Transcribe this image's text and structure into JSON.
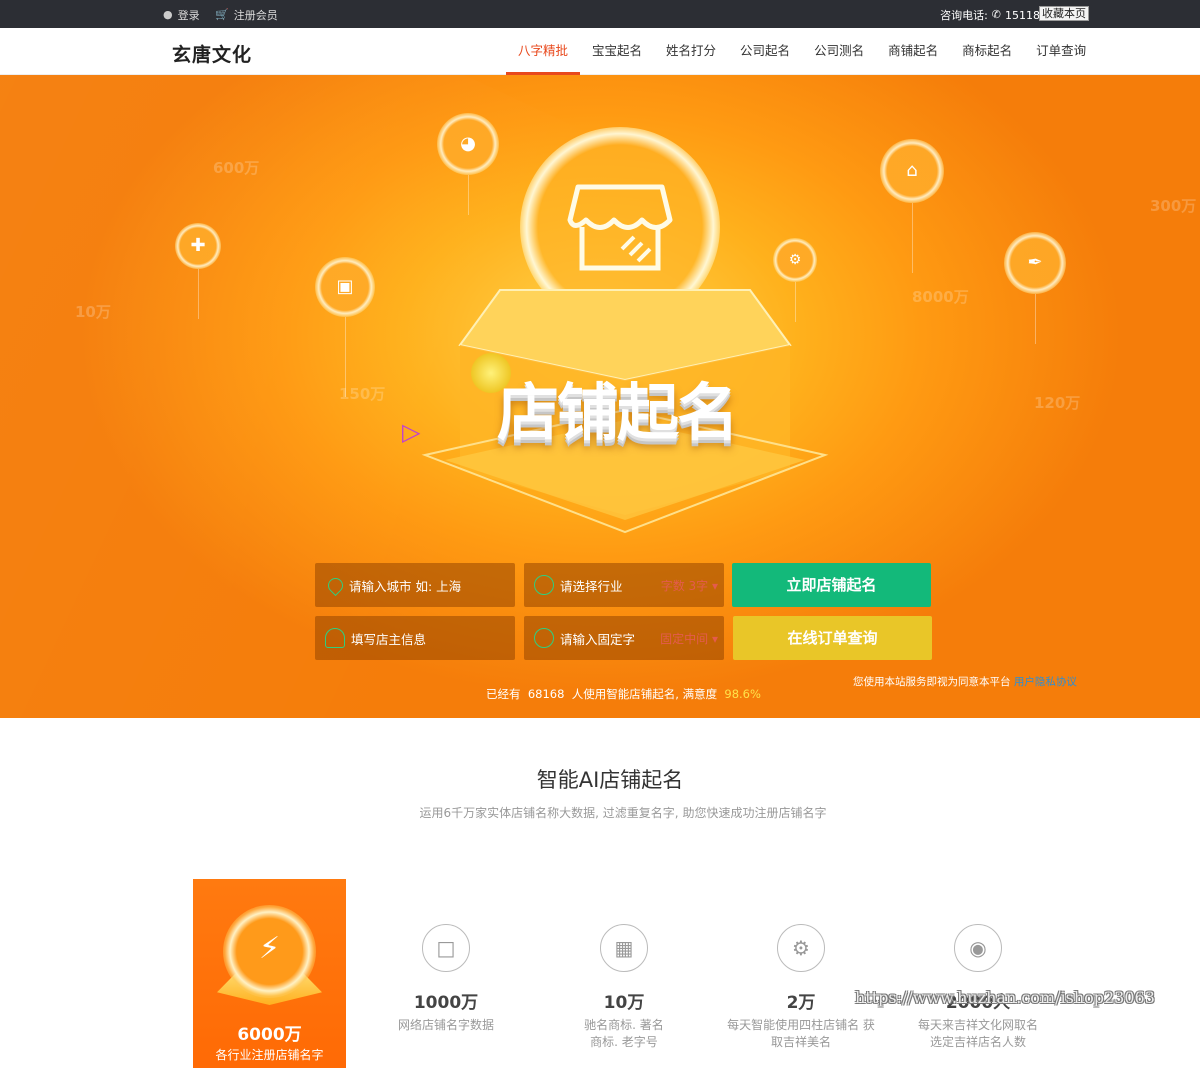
{
  "topbar": {
    "login_label": "登录",
    "register_label": "注册会员",
    "phone_label": "咨询电话:",
    "phone_number": "15118076172",
    "favorite_label": "收藏本页"
  },
  "nav": {
    "logo": "玄唐文化",
    "links": [
      {
        "label": "八字精批",
        "active": true
      },
      {
        "label": "宝宝起名"
      },
      {
        "label": "姓名打分"
      },
      {
        "label": "公司起名"
      },
      {
        "label": "公司测名"
      },
      {
        "label": "商铺起名"
      },
      {
        "label": "商标起名"
      },
      {
        "label": "订单查询"
      }
    ]
  },
  "hero": {
    "title": "店铺起名",
    "ghost_numbers": [
      "600万",
      "10万",
      "150万",
      "300万",
      "8000万",
      "120万"
    ],
    "form": {
      "city_placeholder": "请输入城市 如: 上海",
      "industry_placeholder": "请选择行业",
      "word_count_hint": "字数 3字",
      "owner_placeholder": "填写店主信息",
      "fixed_char_placeholder": "请输入固定字",
      "fixed_position_hint": "固定中间",
      "submit_label": "立即店铺起名",
      "order_label": "在线订单查询"
    },
    "stats": {
      "prefix": "已经有",
      "users": "68168",
      "middle": "人使用智能店铺起名, 满意度",
      "satisfaction": "98.6%"
    },
    "terms": {
      "text": "您使用本站服务即视为同意本平台",
      "link": "用户隐私协议"
    }
  },
  "section": {
    "title": "智能AI店铺起名",
    "subtitle": "运用6千万家实体店铺名称大数据, 过滤重复名字, 助您快速成功注册店铺名字",
    "main_card": {
      "number": "6000万",
      "label": "各行业注册店铺名字"
    },
    "features": [
      {
        "icon": "document-icon",
        "number": "1000万",
        "label": "网络店铺名字数据"
      },
      {
        "icon": "building-icon",
        "number": "10万",
        "label": "驰名商标. 著名商标. 老字号"
      },
      {
        "icon": "gear-icon",
        "number": "2万",
        "label": "每天智能使用四柱店铺名 获取吉祥美名"
      },
      {
        "icon": "location-icon",
        "number": "2000人",
        "label": "每天来吉祥文化网取名 选定吉祥店名人数"
      }
    ]
  },
  "watermark": "https://www.huzhan.com/ishop23063",
  "colors": {
    "accent": "#e8491d",
    "green_button": "#13b97a",
    "yellow_button": "#e9c628",
    "hero_orange": "#ff9a12"
  }
}
